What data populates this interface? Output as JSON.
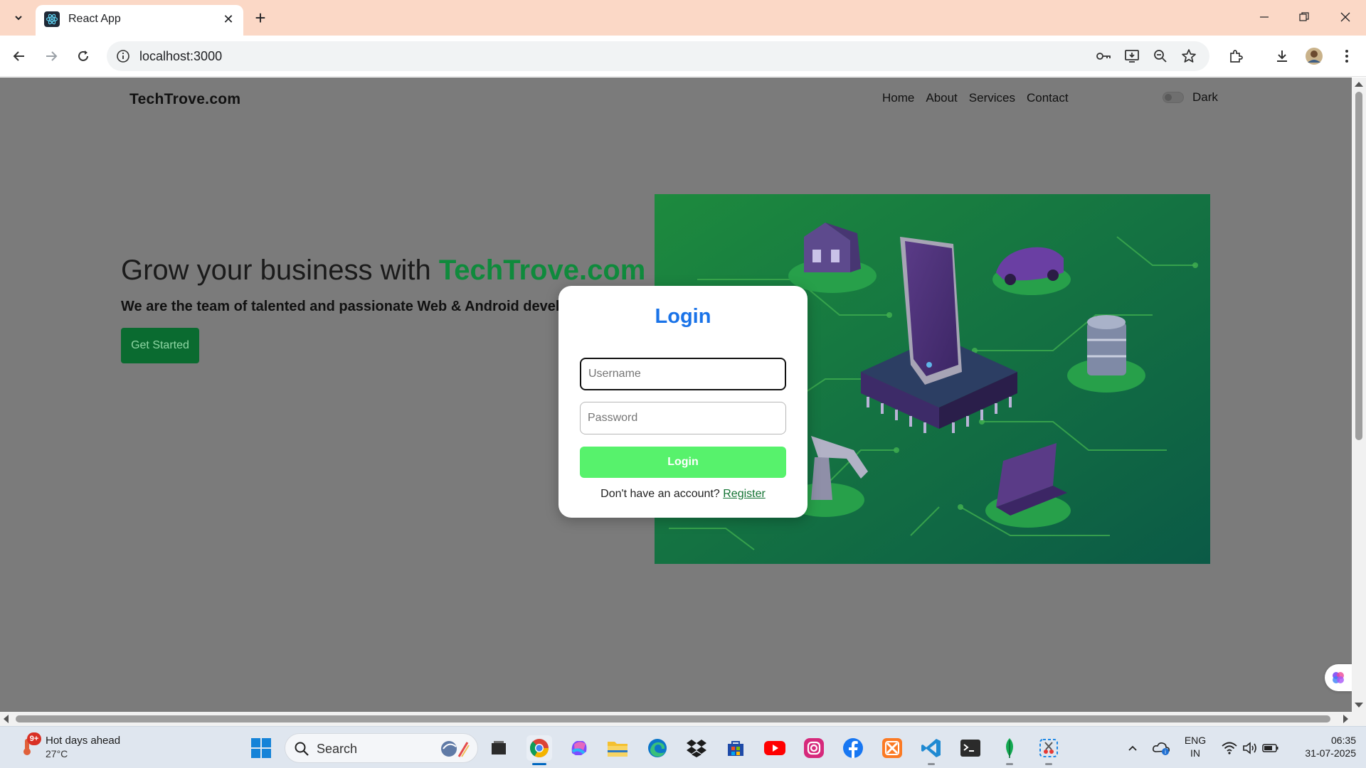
{
  "browser": {
    "tab_title": "React App",
    "url": "localhost:3000"
  },
  "site": {
    "logo": "TechTrove.com",
    "nav": [
      "Home",
      "About",
      "Services",
      "Contact"
    ],
    "dark_label": "Dark",
    "hero_title_prefix": "Grow your business with ",
    "hero_title_brand": "TechTrove.com",
    "hero_subtitle": "We are the team of talented and passionate Web & Android develop",
    "cta_label": "Get Started"
  },
  "login_modal": {
    "title": "Login",
    "username_placeholder": "Username",
    "password_placeholder": "Password",
    "submit_label": "Login",
    "footer_text": "Don't have an account? ",
    "register_link": "Register"
  },
  "taskbar": {
    "weather_text": "Hot days ahead",
    "weather_temp": "27°C",
    "weather_badge": "9+",
    "search_label": "Search",
    "lang_top": "ENG",
    "lang_bottom": "IN",
    "time": "06:35",
    "date": "31-07-2025"
  },
  "colors": {
    "accent_brand": "#0f8a3c",
    "login_title": "#1a73e8",
    "login_button": "#57f26c",
    "overlay_bg": "#7b7b7b",
    "tab_strip": "#fbd8c6"
  }
}
